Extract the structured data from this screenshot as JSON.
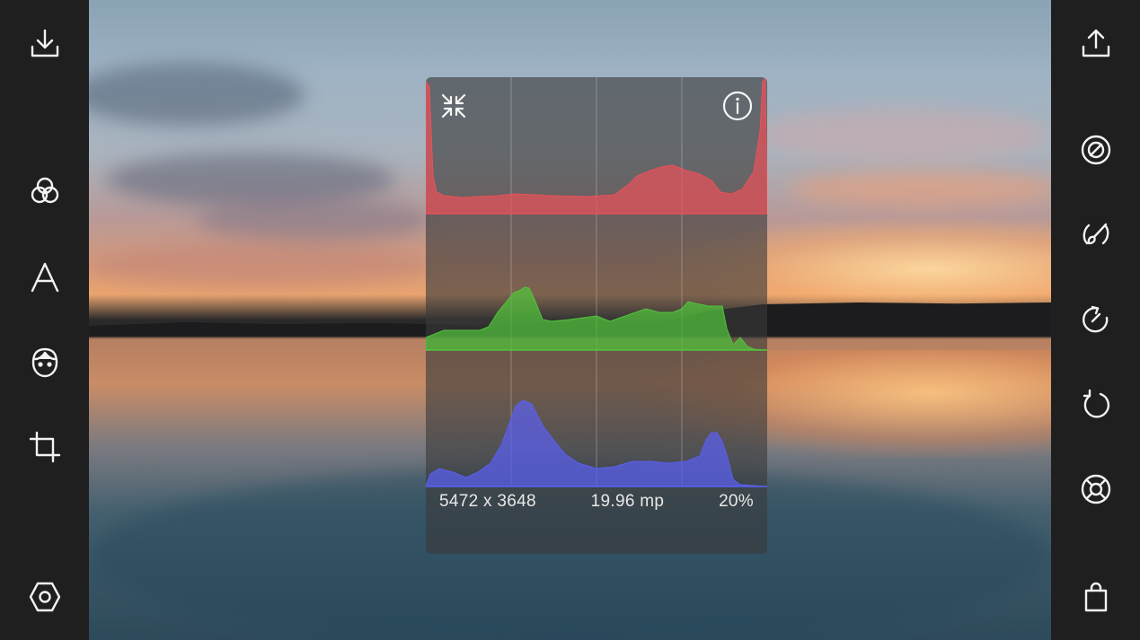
{
  "left_toolbar": {
    "items": [
      {
        "name": "download-icon"
      },
      {
        "name": "filters-icon"
      },
      {
        "name": "text-icon"
      },
      {
        "name": "face-icon"
      },
      {
        "name": "crop-icon"
      },
      {
        "name": "settings-icon"
      }
    ]
  },
  "right_toolbar": {
    "items": [
      {
        "name": "share-icon"
      },
      {
        "name": "vignette-icon"
      },
      {
        "name": "brush-icon"
      },
      {
        "name": "redo-icon"
      },
      {
        "name": "undo-icon"
      },
      {
        "name": "help-icon"
      },
      {
        "name": "store-icon"
      }
    ]
  },
  "histogram": {
    "colors": {
      "red": "#e8525a",
      "green": "#52c43c",
      "blue": "#5a5ff0"
    },
    "info": {
      "dimensions": "5472 x 3648",
      "megapixels": "19.96 mp",
      "zoom": "20%"
    }
  }
}
